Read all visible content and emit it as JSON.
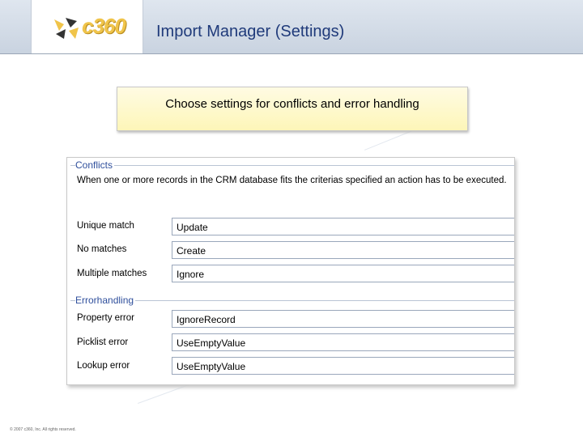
{
  "header": {
    "logo_text": "c360",
    "title": "Import Manager (Settings)"
  },
  "banner": {
    "text": "Choose settings for conflicts and error handling"
  },
  "conflicts": {
    "title": "Conflicts",
    "description": "When one or more records in the CRM database fits the criterias specified an action has to be executed.",
    "rows": [
      {
        "label": "Unique match",
        "value": "Update"
      },
      {
        "label": "No matches",
        "value": "Create"
      },
      {
        "label": "Multiple matches",
        "value": "Ignore"
      }
    ]
  },
  "errorhandling": {
    "title": "Errorhandling",
    "rows": [
      {
        "label": "Property error",
        "value": "IgnoreRecord"
      },
      {
        "label": "Picklist error",
        "value": "UseEmptyValue"
      },
      {
        "label": "Lookup error",
        "value": "UseEmptyValue"
      }
    ]
  },
  "footer": {
    "copyright": "© 2007 c360, Inc. All rights reserved."
  },
  "colors": {
    "title": "#1f3a7a",
    "group_title": "#2f4f9c",
    "logo": "#f0c44a"
  }
}
